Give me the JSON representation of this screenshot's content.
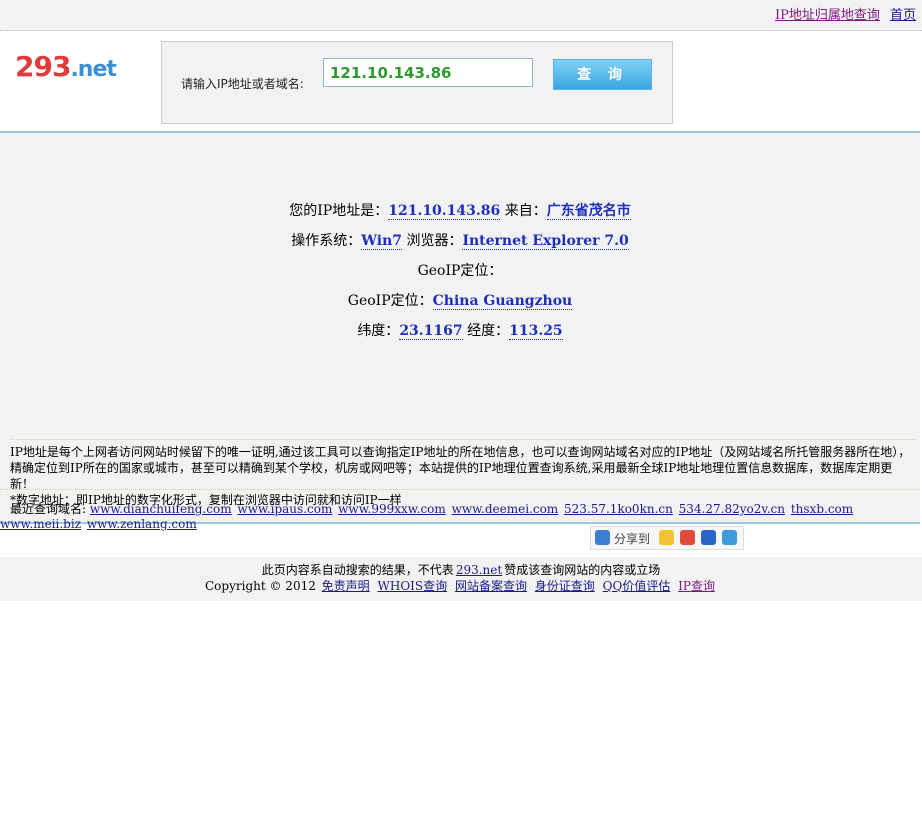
{
  "topbar": {
    "links": [
      {
        "label": "IP地址归属地查询",
        "visited": true
      },
      {
        "label": "首页",
        "visited": false
      }
    ]
  },
  "logo": {
    "number": "293",
    "domain": ".net"
  },
  "search": {
    "label": "请输入IP地址或者域名:",
    "value": "121.10.143.86",
    "button": "查 询"
  },
  "result": {
    "ip_label": "您的IP地址是：",
    "ip": "121.10.143.86",
    "from_label": "来自：",
    "location": "广东省茂名市",
    "os_label": "操作系统：",
    "os": "Win7",
    "browser_label": "浏览器：",
    "browser": "Internet Explorer 7.0",
    "geoip_label_1": "GeoIP定位：",
    "geoip_label_2": "GeoIP定位：",
    "geoip": "China Guangzhou",
    "lat_label": "纬度：",
    "lat": "23.1167",
    "lng_label": "经度：",
    "lng": "113.25"
  },
  "info": {
    "line1": "IP地址是每个上网者访问网站时候留下的唯一证明,通过该工具可以查询指定IP地址的所在地信息，也可以查询网站域名对应的IP地址（及网站域名所托管服务器所在地），精确定位到IP所在的国家或城市，甚至可以精确到某个学校，机房或网吧等；本站提供的IP地理位置查询系统,采用最新全球IP地址地理位置信息数据库，数据库定期更新！",
    "line2": "*数字地址：即IP地址的数字化形式，复制在浏览器中访问就和访问IP一样"
  },
  "recent": {
    "label": "最近查询域名:",
    "domains": [
      "www.dianchuifeng.com",
      "www.ipaus.com",
      "www.999xxw.com",
      "www.deemei.com",
      "523.57.1ko0kn.cn",
      "534.27.82yo2v.cn",
      "thsxb.com",
      "www.meii.biz",
      "www.zenlang.com"
    ]
  },
  "share": {
    "label": "分享到"
  },
  "footer": {
    "line1_prefix": "此页内容系自动搜索的结果，不代表",
    "line1_link": "293.net",
    "line1_suffix": "赞成该查询网站的内容或立场",
    "copyright": "Copyright © 2012",
    "links": [
      "免责声明",
      "WHOIS查询",
      "网站备案查询",
      "身份证查询",
      "QQ价值评估",
      "IP查询"
    ]
  }
}
